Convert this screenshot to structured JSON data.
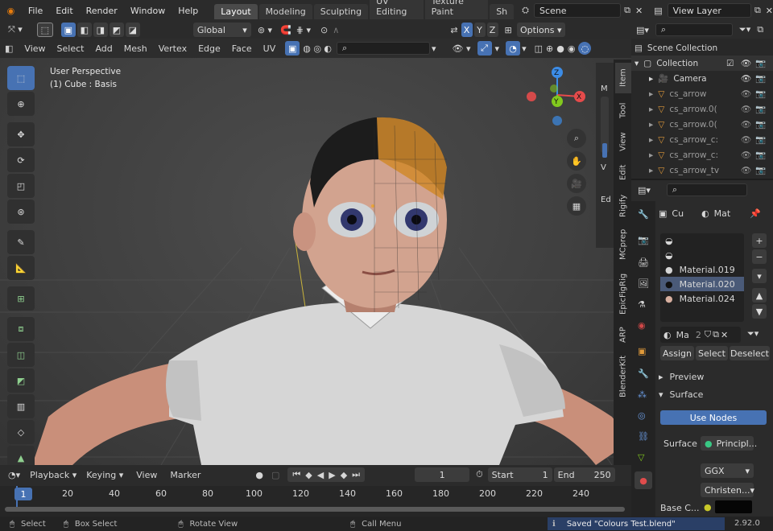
{
  "top_menu": [
    "File",
    "Edit",
    "Render",
    "Window",
    "Help"
  ],
  "workspace_tabs": [
    "Layout",
    "Modeling",
    "Sculpting",
    "UV Editing",
    "Texture Paint",
    "Sh"
  ],
  "scene_name": "Scene",
  "view_layer": "View Layer",
  "header2": {
    "orientation": "Global",
    "axes": [
      "X",
      "Y",
      "Z"
    ],
    "options": "Options"
  },
  "viewport_menu": [
    "View",
    "Select",
    "Add",
    "Mesh",
    "Vertex",
    "Edge",
    "Face",
    "UV"
  ],
  "viewport_overlay": {
    "line1": "User Perspective",
    "line2": "(1) Cube : Basis"
  },
  "gizmo": {
    "z": "Z",
    "y": "Y",
    "x": "X"
  },
  "sidebar_tabs": [
    "Item",
    "Tool",
    "View",
    "Edit",
    "Rigify",
    "MCprep",
    "EpicFigRig",
    "ARP",
    "BlenderKit"
  ],
  "npanel_letters": [
    "M",
    "V",
    "Ed"
  ],
  "outliner": {
    "title": "Scene Collection",
    "collection": "Collection",
    "items": [
      "Camera",
      "cs_arrow",
      "cs_arrow.0(",
      "cs_arrow.0(",
      "cs_arrow_c:",
      "cs_arrow_c:",
      "cs_arrow_tv"
    ]
  },
  "properties": {
    "object_short": "Cu",
    "material_short": "Mat",
    "slots": [
      "",
      "",
      "Material.019",
      "Material.020",
      "Material.024"
    ],
    "selected_slot": "Material.020",
    "mat_name": "Ma",
    "user_count": "2",
    "assign": "Assign",
    "select": "Select",
    "deselect": "Deselect",
    "preview": "Preview",
    "surface_header": "Surface",
    "use_nodes": "Use Nodes",
    "surface_label": "Surface",
    "surface_value": "Principl...",
    "distribution": "GGX",
    "subsurface": "Christen...",
    "base_color": "Base C..."
  },
  "timeline": {
    "menus": [
      "Playback",
      "Keying",
      "View",
      "Marker"
    ],
    "current_frame": "1",
    "start_label": "Start",
    "start": "1",
    "end_label": "End",
    "end": "250",
    "ruler": [
      "1",
      "20",
      "40",
      "60",
      "80",
      "100",
      "120",
      "140",
      "160",
      "180",
      "200",
      "220",
      "240"
    ]
  },
  "status": {
    "select": "Select",
    "box_select": "Box Select",
    "rotate": "Rotate View",
    "call_menu": "Call Menu",
    "message": "Saved \"Colours Test.blend\"",
    "version": "2.92.0"
  },
  "colors": {
    "accent": "#4772b3",
    "x_axis": "#e64b4b",
    "y_axis": "#82c81e",
    "z_axis": "#3c8ce6"
  }
}
